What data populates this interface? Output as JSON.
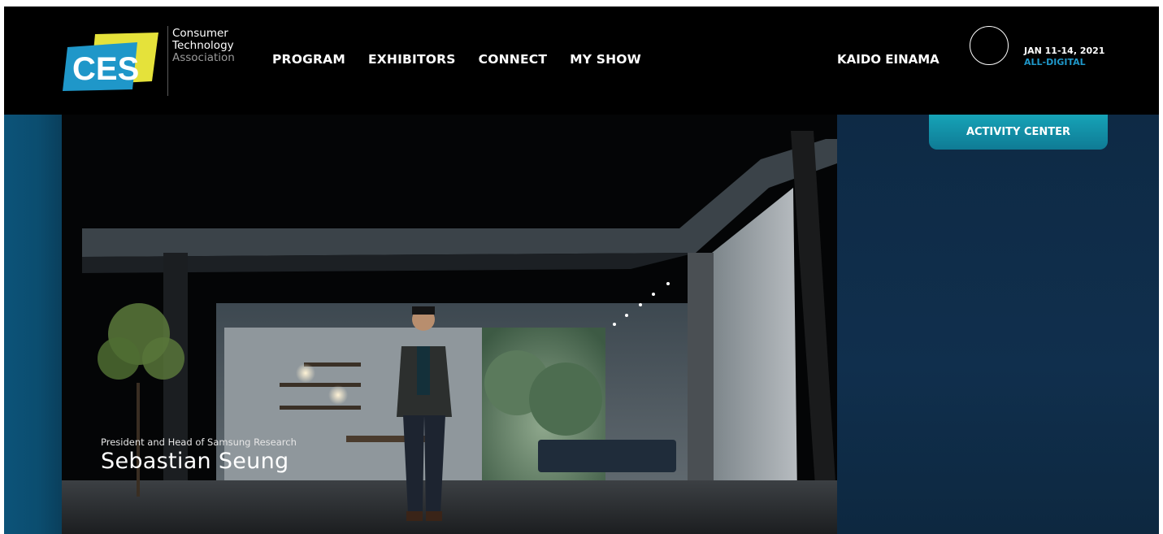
{
  "logo": {
    "ces_text": "CES",
    "association_lines": [
      "Consumer",
      "Technology",
      "Association"
    ]
  },
  "nav": {
    "items": [
      "PROGRAM",
      "EXHIBITORS",
      "CONNECT",
      "MY SHOW"
    ]
  },
  "user": {
    "name": "KAIDO EINAMA"
  },
  "show": {
    "date": "JAN 11-14, 2021",
    "format": "ALL-DIGITAL"
  },
  "activity_center": {
    "label": "ACTIVITY CENTER"
  },
  "video": {
    "speaker_title": "President and Head of Samsung Research",
    "speaker_name": "Sebastian Seung"
  },
  "colors": {
    "header_bg": "#000000",
    "accent_blue": "#1f97c9",
    "panel_navy": "#0f2c45",
    "activity_teal": "#138ea6"
  },
  "icons": [
    "ces-logo-icon",
    "avatar-icon"
  ]
}
